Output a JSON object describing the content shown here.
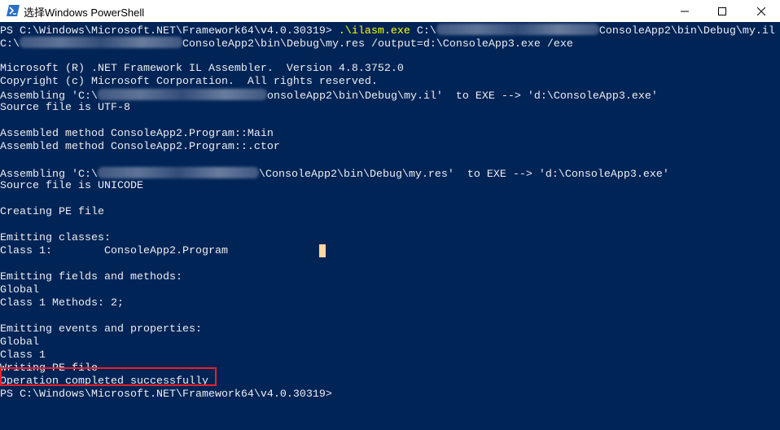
{
  "window": {
    "title": "选择Windows PowerShell",
    "controls": [
      "minimize",
      "maximize",
      "close"
    ]
  },
  "colors": {
    "background": "#012456",
    "text": "#eeedf0",
    "command": "#ffff00",
    "cursor": "#fed7a4",
    "highlight_box": "#e8202a"
  },
  "console": {
    "prompt": "PS C:\\Windows\\Microsoft.NET\\Framework64\\v4.0.30319> ",
    "command": ".\\ilasm.exe",
    "cmd_arg1_prefix": " C:\\",
    "cmd_arg1_suffix": "ConsoleApp2\\bin\\Debug\\my.il",
    "cmd_line2_prefix": "C:\\",
    "cmd_line2_suffix": "ConsoleApp2\\bin\\Debug\\my.res /output=d:\\ConsoleApp3.exe /exe",
    "banner1": "Microsoft (R) .NET Framework IL Assembler.  Version 4.8.3752.0",
    "banner2": "Copyright (c) Microsoft Corporation.  All rights reserved.",
    "asm1_prefix": "Assembling 'C:\\",
    "asm1_suffix": "onsoleApp2\\bin\\Debug\\my.il'  to EXE --> 'd:\\ConsoleApp3.exe'",
    "src1": "Source file is UTF-8",
    "method1": "Assembled method ConsoleApp2.Program::Main",
    "method2": "Assembled method ConsoleApp2.Program::.ctor",
    "asm2_prefix": "Assembling 'C:\\",
    "asm2_suffix": "\\ConsoleApp2\\bin\\Debug\\my.res'  to EXE --> 'd:\\ConsoleApp3.exe'",
    "src2": "Source file is UNICODE",
    "creating": "Creating PE file",
    "emit_classes": "Emitting classes:",
    "class1": "Class 1:        ConsoleApp2.Program",
    "emit_fields": "Emitting fields and methods:",
    "global1": "Global",
    "class1_methods": "Class 1 Methods: 2;",
    "emit_events": "Emitting events and properties:",
    "global2": "Global",
    "class1b": "Class 1",
    "writing": "Writing PE file",
    "success": "Operation completed successfully",
    "final_prompt": "PS C:\\Windows\\Microsoft.NET\\Framework64\\v4.0.30319>"
  }
}
